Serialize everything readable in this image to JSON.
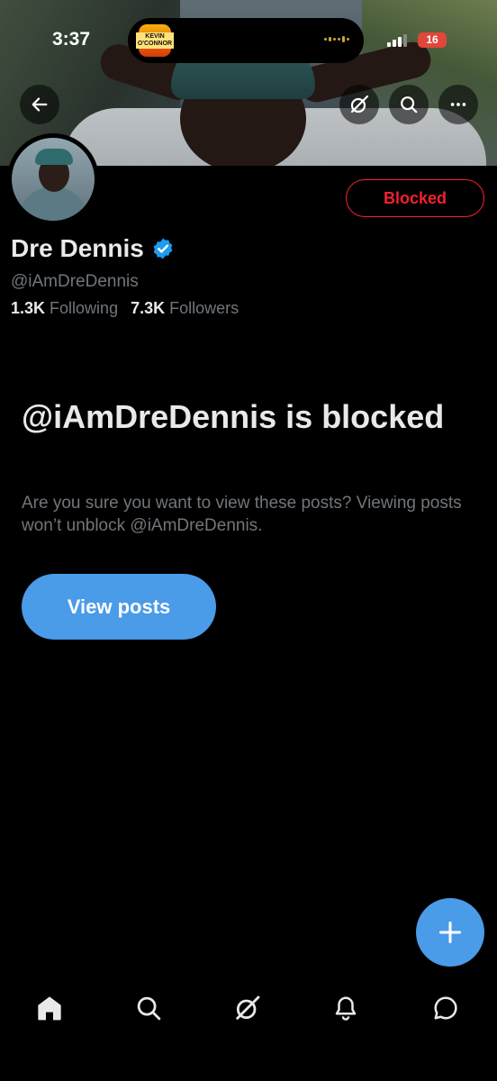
{
  "status_bar": {
    "time": "3:37",
    "island_app_label": "KEVIN O'CONNOR",
    "battery": "16"
  },
  "header": {
    "back_icon": "arrow-left-icon",
    "grok_icon": "grok-icon",
    "search_icon": "search-icon",
    "more_icon": "more-horizontal-icon"
  },
  "profile": {
    "name": "Dre Dennis",
    "verified_icon": "verified-badge-icon",
    "verified_color": "#1d9bf0",
    "handle": "@iAmDreDennis",
    "following_count": "1.3K",
    "following_label": "Following",
    "followers_count": "7.3K",
    "followers_label": "Followers",
    "blocked_button_label": "Blocked"
  },
  "blocked_notice": {
    "title": "@iAmDreDennis is blocked",
    "description": "Are you sure you want to view these posts? Viewing posts won’t unblock @iAmDreDennis.",
    "view_posts_label": "View posts"
  },
  "fab": {
    "icon": "plus-icon"
  },
  "bottom_nav": {
    "items": [
      "home-icon",
      "search-icon",
      "grok-icon",
      "notifications-bell-icon",
      "messages-icon"
    ]
  },
  "colors": {
    "accent": "#4a9be8",
    "blocked_red": "#f4212e",
    "secondary_text": "#71767b",
    "background": "#000000"
  }
}
